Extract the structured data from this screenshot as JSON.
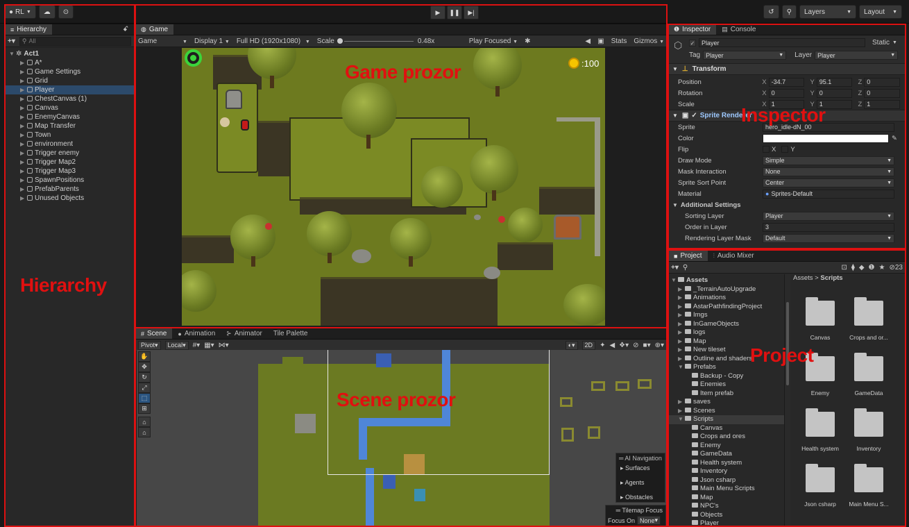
{
  "toolbar": {
    "account": "RL",
    "layers": "Layers",
    "layout": "Layout"
  },
  "hierarchy": {
    "tab": "Hierarchy",
    "search_placeholder": "All",
    "scene": "Act1",
    "items": [
      "A*",
      "Game Settings",
      "Grid",
      "Player",
      "ChestCanvas (1)",
      "Canvas",
      "EnemyCanvas",
      "Map Transfer",
      "Town",
      "environment",
      "Trigger enemy",
      "Trigger Map2",
      "Trigger Map3",
      "SpawnPositions",
      "PrefabParents",
      "Unused Objects"
    ],
    "selected": "Player",
    "annotation": "Hierarchy"
  },
  "game": {
    "tab": "Game",
    "mode": "Game",
    "display": "Display 1",
    "resolution": "Full HD (1920x1080)",
    "scale_label": "Scale",
    "scale_value": "0.48x",
    "play_focused": "Play Focused",
    "stats": "Stats",
    "gizmos": "Gizmos",
    "coin_count": ":100",
    "annotation": "Game prozor"
  },
  "scene": {
    "tabs": [
      "Scene",
      "Animation",
      "Animator",
      "Tile Palette"
    ],
    "pivot": "Pivot",
    "local": "Local",
    "mode_2d": "2D",
    "ai_nav": {
      "title": "AI Navigation",
      "items": [
        "Surfaces",
        "Agents",
        "Obstacles"
      ]
    },
    "tilemap_focus": "Tilemap Focus",
    "focus_on_label": "Focus On",
    "focus_on_value": "None",
    "annotation": "Scene prozor"
  },
  "inspector": {
    "tabs": [
      "Inspector",
      "Console"
    ],
    "object_name": "Player",
    "static": "Static",
    "tag_label": "Tag",
    "tag": "Player",
    "layer_label": "Layer",
    "layer": "Player",
    "transform": {
      "title": "Transform",
      "rows": [
        {
          "label": "Position",
          "x": "-34.7",
          "y": "95.1",
          "z": "0"
        },
        {
          "label": "Rotation",
          "x": "0",
          "y": "0",
          "z": "0"
        },
        {
          "label": "Scale",
          "x": "1",
          "y": "1",
          "z": "1"
        }
      ]
    },
    "sprite_renderer": {
      "title": "Sprite Renderer",
      "sprite_label": "Sprite",
      "sprite": "hero_idle-dN_00",
      "color_label": "Color",
      "flip_label": "Flip",
      "flip_x": "X",
      "flip_y": "Y",
      "draw_mode_label": "Draw Mode",
      "draw_mode": "Simple",
      "mask_label": "Mask Interaction",
      "mask": "None",
      "sort_point_label": "Sprite Sort Point",
      "sort_point": "Center",
      "material_label": "Material",
      "material": "Sprites-Default"
    },
    "additional": {
      "title": "Additional Settings",
      "sorting_layer_label": "Sorting Layer",
      "sorting_layer": "Player",
      "order_label": "Order in Layer",
      "order": "3",
      "rendering_label": "Rendering Layer Mask",
      "rendering": "Default"
    },
    "annotation": "Inspector"
  },
  "project": {
    "tabs": [
      "Project",
      "Audio Mixer"
    ],
    "hidden_count": "23",
    "breadcrumb_root": "Assets",
    "breadcrumb_sep": ">",
    "breadcrumb_current": "Scripts",
    "tree": [
      {
        "label": "Assets",
        "level": 0,
        "bold": true
      },
      {
        "label": "_TerrainAutoUpgrade",
        "level": 1
      },
      {
        "label": "Animations",
        "level": 1
      },
      {
        "label": "AstarPathfindingProject",
        "level": 1
      },
      {
        "label": "Imgs",
        "level": 1
      },
      {
        "label": "InGameObjects",
        "level": 1
      },
      {
        "label": "logs",
        "level": 1
      },
      {
        "label": "Map",
        "level": 1
      },
      {
        "label": "New tileset",
        "level": 1
      },
      {
        "label": "Outline and shaders",
        "level": 1
      },
      {
        "label": "Prefabs",
        "level": 1
      },
      {
        "label": "Backup - Copy",
        "level": 2
      },
      {
        "label": "Enemies",
        "level": 2
      },
      {
        "label": "Item prefab",
        "level": 2
      },
      {
        "label": "saves",
        "level": 1
      },
      {
        "label": "Scenes",
        "level": 1
      },
      {
        "label": "Scripts",
        "level": 1
      },
      {
        "label": "Canvas",
        "level": 2
      },
      {
        "label": "Crops and ores",
        "level": 2
      },
      {
        "label": "Enemy",
        "level": 2
      },
      {
        "label": "GameData",
        "level": 2
      },
      {
        "label": "Health system",
        "level": 2
      },
      {
        "label": "Inventory",
        "level": 2
      },
      {
        "label": "Json csharp",
        "level": 2
      },
      {
        "label": "Main Menu Scripts",
        "level": 2
      },
      {
        "label": "Map",
        "level": 2
      },
      {
        "label": "NPC's",
        "level": 2
      },
      {
        "label": "Objects",
        "level": 2
      },
      {
        "label": "Player",
        "level": 2
      }
    ],
    "grid": [
      "Canvas",
      "Crops and or...",
      "Enemy",
      "GameData",
      "Health system",
      "Inventory",
      "Json csharp",
      "Main Menu S..."
    ],
    "annotation": "Project"
  },
  "colors": {
    "highlight": "#d11111",
    "selection": "#2c4a6b",
    "grass": "#6d7a1f",
    "water": "#4f86d8"
  }
}
